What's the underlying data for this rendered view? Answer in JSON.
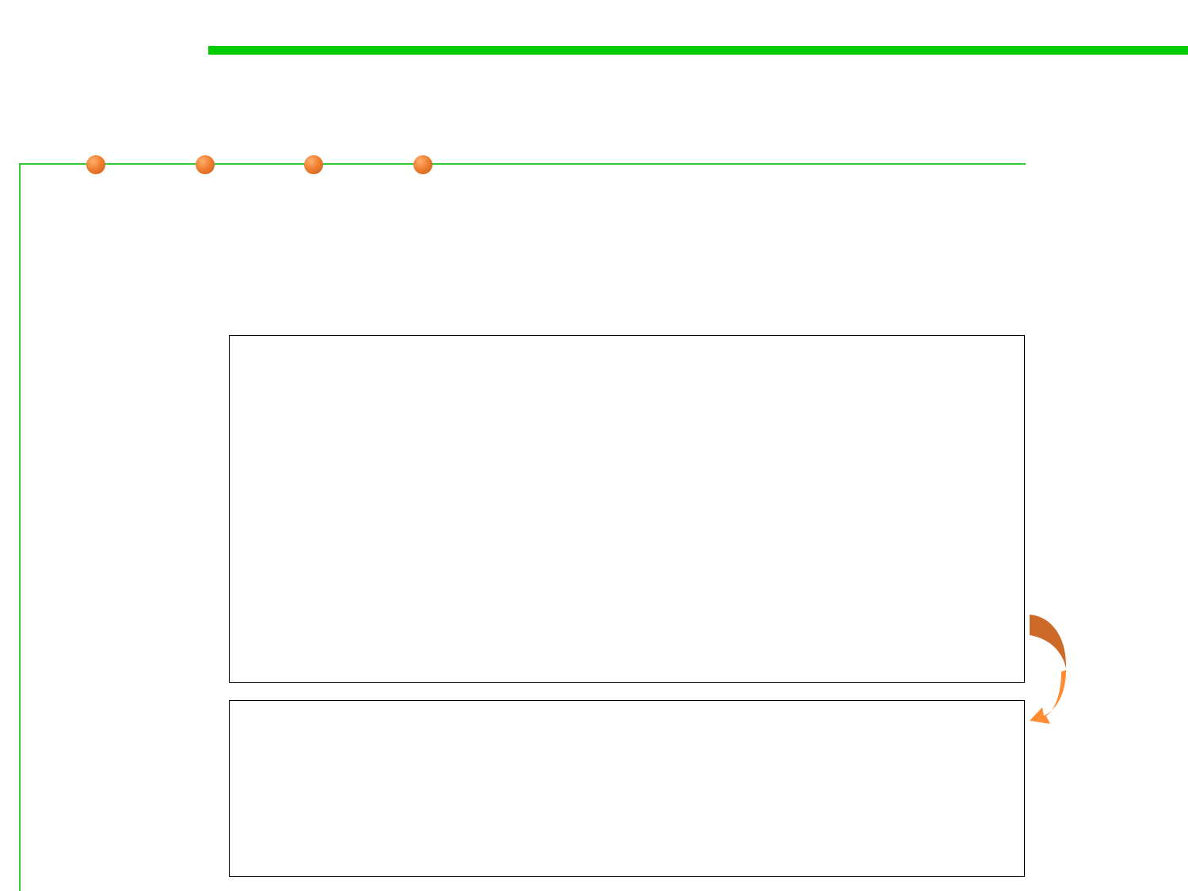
{
  "colors": {
    "accent_green": "#00cc00",
    "line_green": "#33cc33",
    "dot_orange": "#f08030",
    "arrow_dark": "#cc6a2a",
    "arrow_light": "#ff8c33",
    "box_border": "#000000"
  },
  "decor": {
    "dots": [
      "dot",
      "dot",
      "dot",
      "dot"
    ],
    "arrow_icon": "curved-down-left-arrow"
  },
  "upper_box": {
    "text": ""
  },
  "lower_box": {
    "text": ""
  }
}
